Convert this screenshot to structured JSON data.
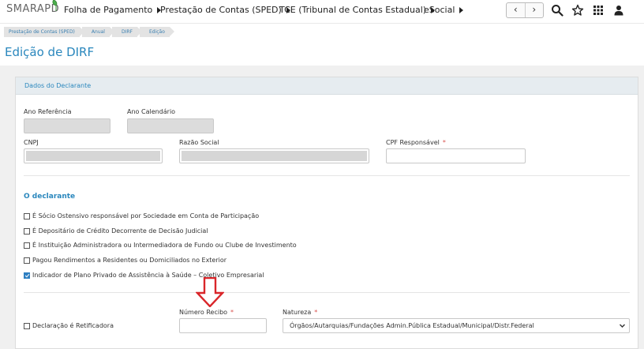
{
  "app": {
    "logo_text": "SMARAPD"
  },
  "nav": {
    "items": [
      {
        "label": "Folha de Pagamento"
      },
      {
        "label": "Prestação de Contas (SPED)"
      },
      {
        "label": "TCE (Tribunal de Contas Estadual)"
      },
      {
        "label": "eSocial"
      }
    ],
    "prev_glyph": "‹",
    "next_glyph": "›",
    "icons": [
      "search-icon",
      "star-icon",
      "grid-apps-icon",
      "user-icon"
    ]
  },
  "breadcrumb": [
    {
      "label": "Prestação de Contas (SPED)"
    },
    {
      "label": "Anual"
    },
    {
      "label": "DIRF"
    },
    {
      "label": "Edição"
    }
  ],
  "page": {
    "title": "Edição de DIRF"
  },
  "declarante": {
    "section_title": "Dados do Declarante",
    "fields": {
      "ano_referencia": {
        "label": "Ano Referência",
        "value": ""
      },
      "ano_calendario": {
        "label": "Ano Calendário",
        "value": ""
      },
      "cnpj": {
        "label": "CNPJ",
        "value": ""
      },
      "razao_social": {
        "label": "Razão Social",
        "value": ""
      },
      "cpf_responsavel": {
        "label": "CPF Responsável",
        "required_mark": "*",
        "value": ""
      }
    }
  },
  "o_declarante": {
    "section_title": "O declarante",
    "checkboxes": [
      {
        "label": "É Sócio Ostensivo responsável por Sociedade em Conta de Participação",
        "checked": false
      },
      {
        "label": "É Depositário de Crédito Decorrente de Decisão Judicial",
        "checked": false
      },
      {
        "label": "É Instituição Administradora ou Intermediadora de Fundo ou Clube de Investimento",
        "checked": false
      },
      {
        "label": "Pagou Rendimentos a Residentes ou Domiciliados no Exterior",
        "checked": false
      },
      {
        "label": "Indicador de Plano Privado de Assistência à Saúde – Coletivo Empresarial",
        "checked": true
      }
    ]
  },
  "retificadora": {
    "checkbox_label": "Declaração é Retificadora",
    "checked": false,
    "numero_recibo": {
      "label": "Número Recibo",
      "required_mark": "*",
      "value": ""
    },
    "natureza": {
      "label": "Natureza",
      "required_mark": "*",
      "selected": "Órgãos/Autarquias/Fundações Admin.Pública Estadual/Municipal/Distr.Federal"
    }
  },
  "colors": {
    "accent": "#2a87bd",
    "annotation_arrow": "#d9262a",
    "checkbox_checked": "#2f7fc1"
  }
}
